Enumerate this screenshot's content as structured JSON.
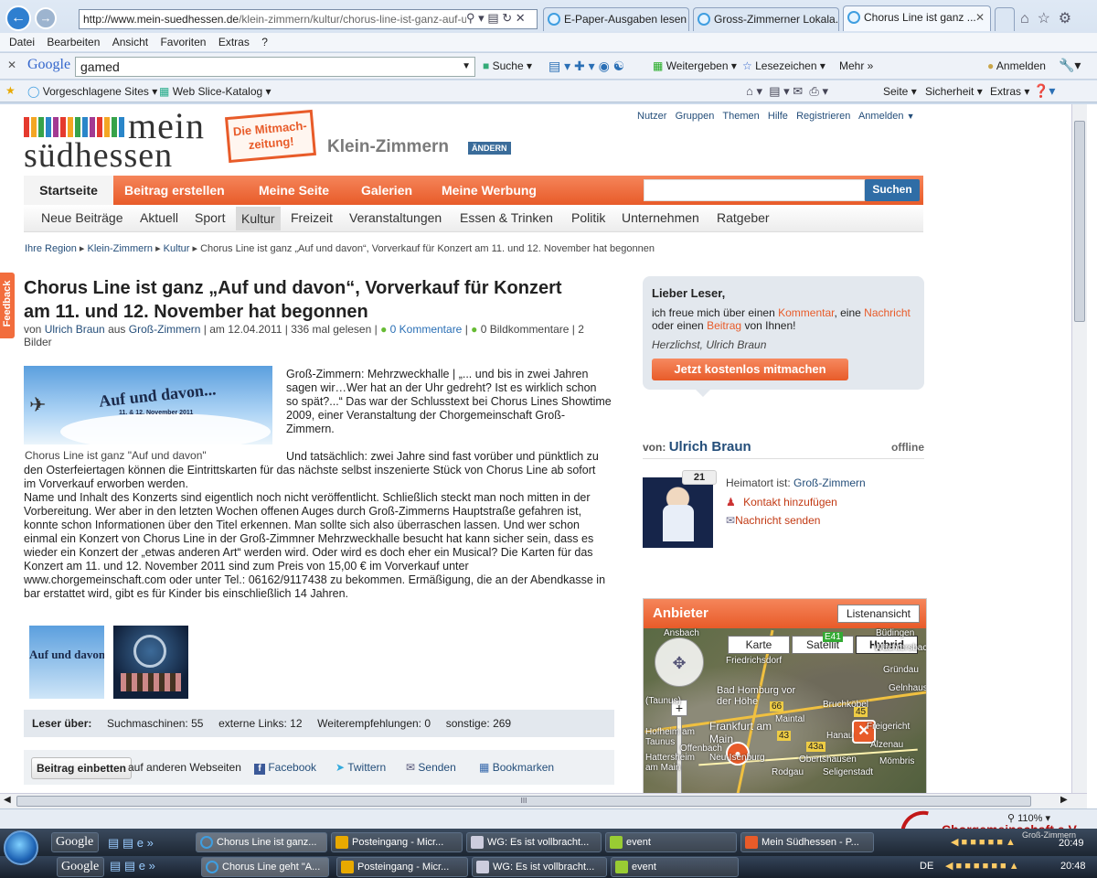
{
  "browser": {
    "url_host": "http://www.mein-suedhessen.de",
    "url_path": "/klein-zimmern/kultur/chorus-line-ist-ganz-auf-ur",
    "tabs": [
      "E-Paper-Ausgaben lesen ...",
      "Gross-Zimmerner Lokala...",
      "Chorus Line ist ganz ..."
    ],
    "menu": [
      "Datei",
      "Bearbeiten",
      "Ansicht",
      "Favoriten",
      "Extras",
      "?"
    ],
    "google_label": "Google",
    "google_query": "gamed",
    "google_tools": [
      "Suche",
      "Weitergeben",
      "Lesezeichen",
      "Mehr »",
      "Anmelden"
    ],
    "favorites": [
      "Vorgeschlagene Sites",
      "Web Slice-Katalog"
    ],
    "command_bar": [
      "Seite",
      "Sicherheit",
      "Extras"
    ],
    "zoom": "110%",
    "hscroll_grip": "III"
  },
  "site": {
    "logo_top": "mein",
    "logo_bottom": "südhessen",
    "badge": "Die Mitmach-zeitung!",
    "region": "Klein-Zimmern",
    "change_label": "ÄNDERN",
    "user_links": [
      "Nutzer",
      "Gruppen",
      "Themen",
      "Hilfe",
      "Registrieren",
      "Anmelden"
    ],
    "main_nav": [
      "Startseite",
      "Beitrag erstellen",
      "Meine Seite",
      "Galerien",
      "Meine Werbung"
    ],
    "search_button": "Suchen",
    "sub_nav": [
      "Neue Beiträge",
      "Aktuell",
      "Sport",
      "Kultur",
      "Freizeit",
      "Veranstaltungen",
      "Essen & Trinken",
      "Politik",
      "Unternehmen",
      "Ratgeber"
    ],
    "breadcrumb": [
      "Ihre Region",
      "Klein-Zimmern",
      "Kultur",
      "Chorus Line ist ganz „Auf und davon“, Vorverkauf für Konzert am 11. und 12. November hat begonnen"
    ],
    "feedback_tab": "Feedback"
  },
  "article": {
    "title": "Chorus Line ist ganz „Auf und davon“, Vorverkauf für Konzert am 11. und 12. November hat begonnen",
    "meta_prefix": "von",
    "author": "Ulrich Braun",
    "meta_aus": "aus",
    "town": "Groß-Zimmern",
    "meta_date": "| am 12.04.2011 | 336 mal gelesen |",
    "comments": "0 Kommentare",
    "image_comments": "0 Bildkommentare |",
    "images_count": "2 Bilder",
    "image_text": "Auf und davon...",
    "image_subtext": "11. & 12. November 2011",
    "image_caption": "Chorus Line ist ganz \"Auf und davon\"",
    "paragraph1": "Groß-Zimmern: Mehrzweckhalle | „... und bis in zwei Jahren sagen wir…Wer hat an der Uhr gedreht? Ist es wirklich schon so spät?...“ Das war der Schlusstext bei Chorus Lines Showtime 2009, einer Veranstaltung der Chorgemeinschaft Groß-Zimmern.",
    "paragraph2": "Und tatsächlich: zwei Jahre sind fast vorüber und pünktlich zu den Osterfeiertagen können die Eintrittskarten für das nächste selbst inszenierte Stück von Chorus Line ab sofort im Vorverkauf erworben werden.",
    "paragraph3": "Name und Inhalt des Konzerts sind eigentlich noch nicht veröffentlicht. Schließlich steckt man noch mitten in der Vorbereitung. Wer aber in den letzten Wochen offenen Auges durch Groß-Zimmerns Hauptstraße gefahren ist, konnte schon Informationen über den Titel erkennen. Man sollte sich also überraschen lassen. Und wer schon einmal ein Konzert von Chorus Line in der Groß-Zimmner Mehrzweckhalle besucht hat kann sicher sein, dass es wieder ein Konzert der „etwas anderen Art“ werden wird. Oder wird es doch eher ein Musical? Die Karten für das Konzert am 11. und 12. November 2011 sind zum Preis von 15,00 € im Vorverkauf unter www.chorgemeinschaft.com oder unter Tel.: 06162/9117438 zu bekommen. Ermäßigung, die an der Abendkasse in bar erstattet wird, gibt es für Kinder bis einschließlich 14 Jahren.",
    "readers_label": "Leser über:",
    "readers_stats": [
      "Suchmaschinen: 55",
      "externe Links: 12",
      "Weiterempfehlungen: 0",
      "sonstige: 269"
    ],
    "embed_button": "Beitrag einbetten",
    "embed_suffix": "auf anderen Webseiten",
    "share": [
      "Facebook",
      "Twittern",
      "Senden",
      "Bookmarken"
    ]
  },
  "sidebar": {
    "greeting": "Lieber Leser,",
    "text_before": "ich freue mich über einen",
    "link1": "Kommentar",
    "text_mid1": ", eine",
    "link2": "Nachricht",
    "text_mid2": "oder einen",
    "link3": "Beitrag",
    "text_after": "von Ihnen!",
    "signature": "Herzlichst, Ulrich Braun",
    "cta": "Jetzt kostenlos mitmachen",
    "author_prefix": "von:",
    "author_name": "Ulrich Braun",
    "status": "offline",
    "avatar_count": "21",
    "hometown_label": "Heimatort ist:",
    "hometown": "Groß-Zimmern",
    "add_contact": "Kontakt hinzufügen",
    "send_message": "Nachricht senden",
    "providers_title": "Anbieter",
    "list_view": "Listenansicht",
    "map_types": [
      "Karte",
      "Satellit",
      "Hybrid"
    ],
    "map_labels": [
      "Friedrichsdorf",
      "Bad Homburg vor der Höhe",
      "Frankfurt am Main",
      "Maintal",
      "Bruchköbel",
      "Freigericht",
      "Hanau",
      "Offenbach",
      "Neu-Isenburg",
      "Obertshausen",
      "Rodgau",
      "Seligenstadt",
      "Alzenau",
      "Mömbris",
      "Gründau",
      "Gelnhausen",
      "Büdingen",
      "Wächtersbach",
      "Ansbach",
      "(Taunus)",
      "Hofheim am Taunus",
      "Hattersheim am Main",
      "45",
      "66",
      "43",
      "43a",
      "E41"
    ]
  },
  "taskbar": {
    "row1": [
      "Google",
      "Chorus Line ist ganz...",
      "Posteingang - Micr...",
      "WG: Es ist vollbracht...",
      "event",
      "Mein Südhessen - P..."
    ],
    "row2": [
      "Google",
      "Chorus Line geht \"A...",
      "Posteingang - Micr...",
      "WG: Es ist vollbracht...",
      "event"
    ],
    "clock1": "20:49",
    "clock2": "20:48",
    "lang": "DE",
    "watermark": "Chorgemeinschaft e.V.",
    "watermark_sub": "Groß-Zimmern"
  },
  "colors": {
    "accent": "#f26d3d",
    "nav_bg": "#f26d3d",
    "link": "#c23a14",
    "blue": "#2a6fb5"
  }
}
